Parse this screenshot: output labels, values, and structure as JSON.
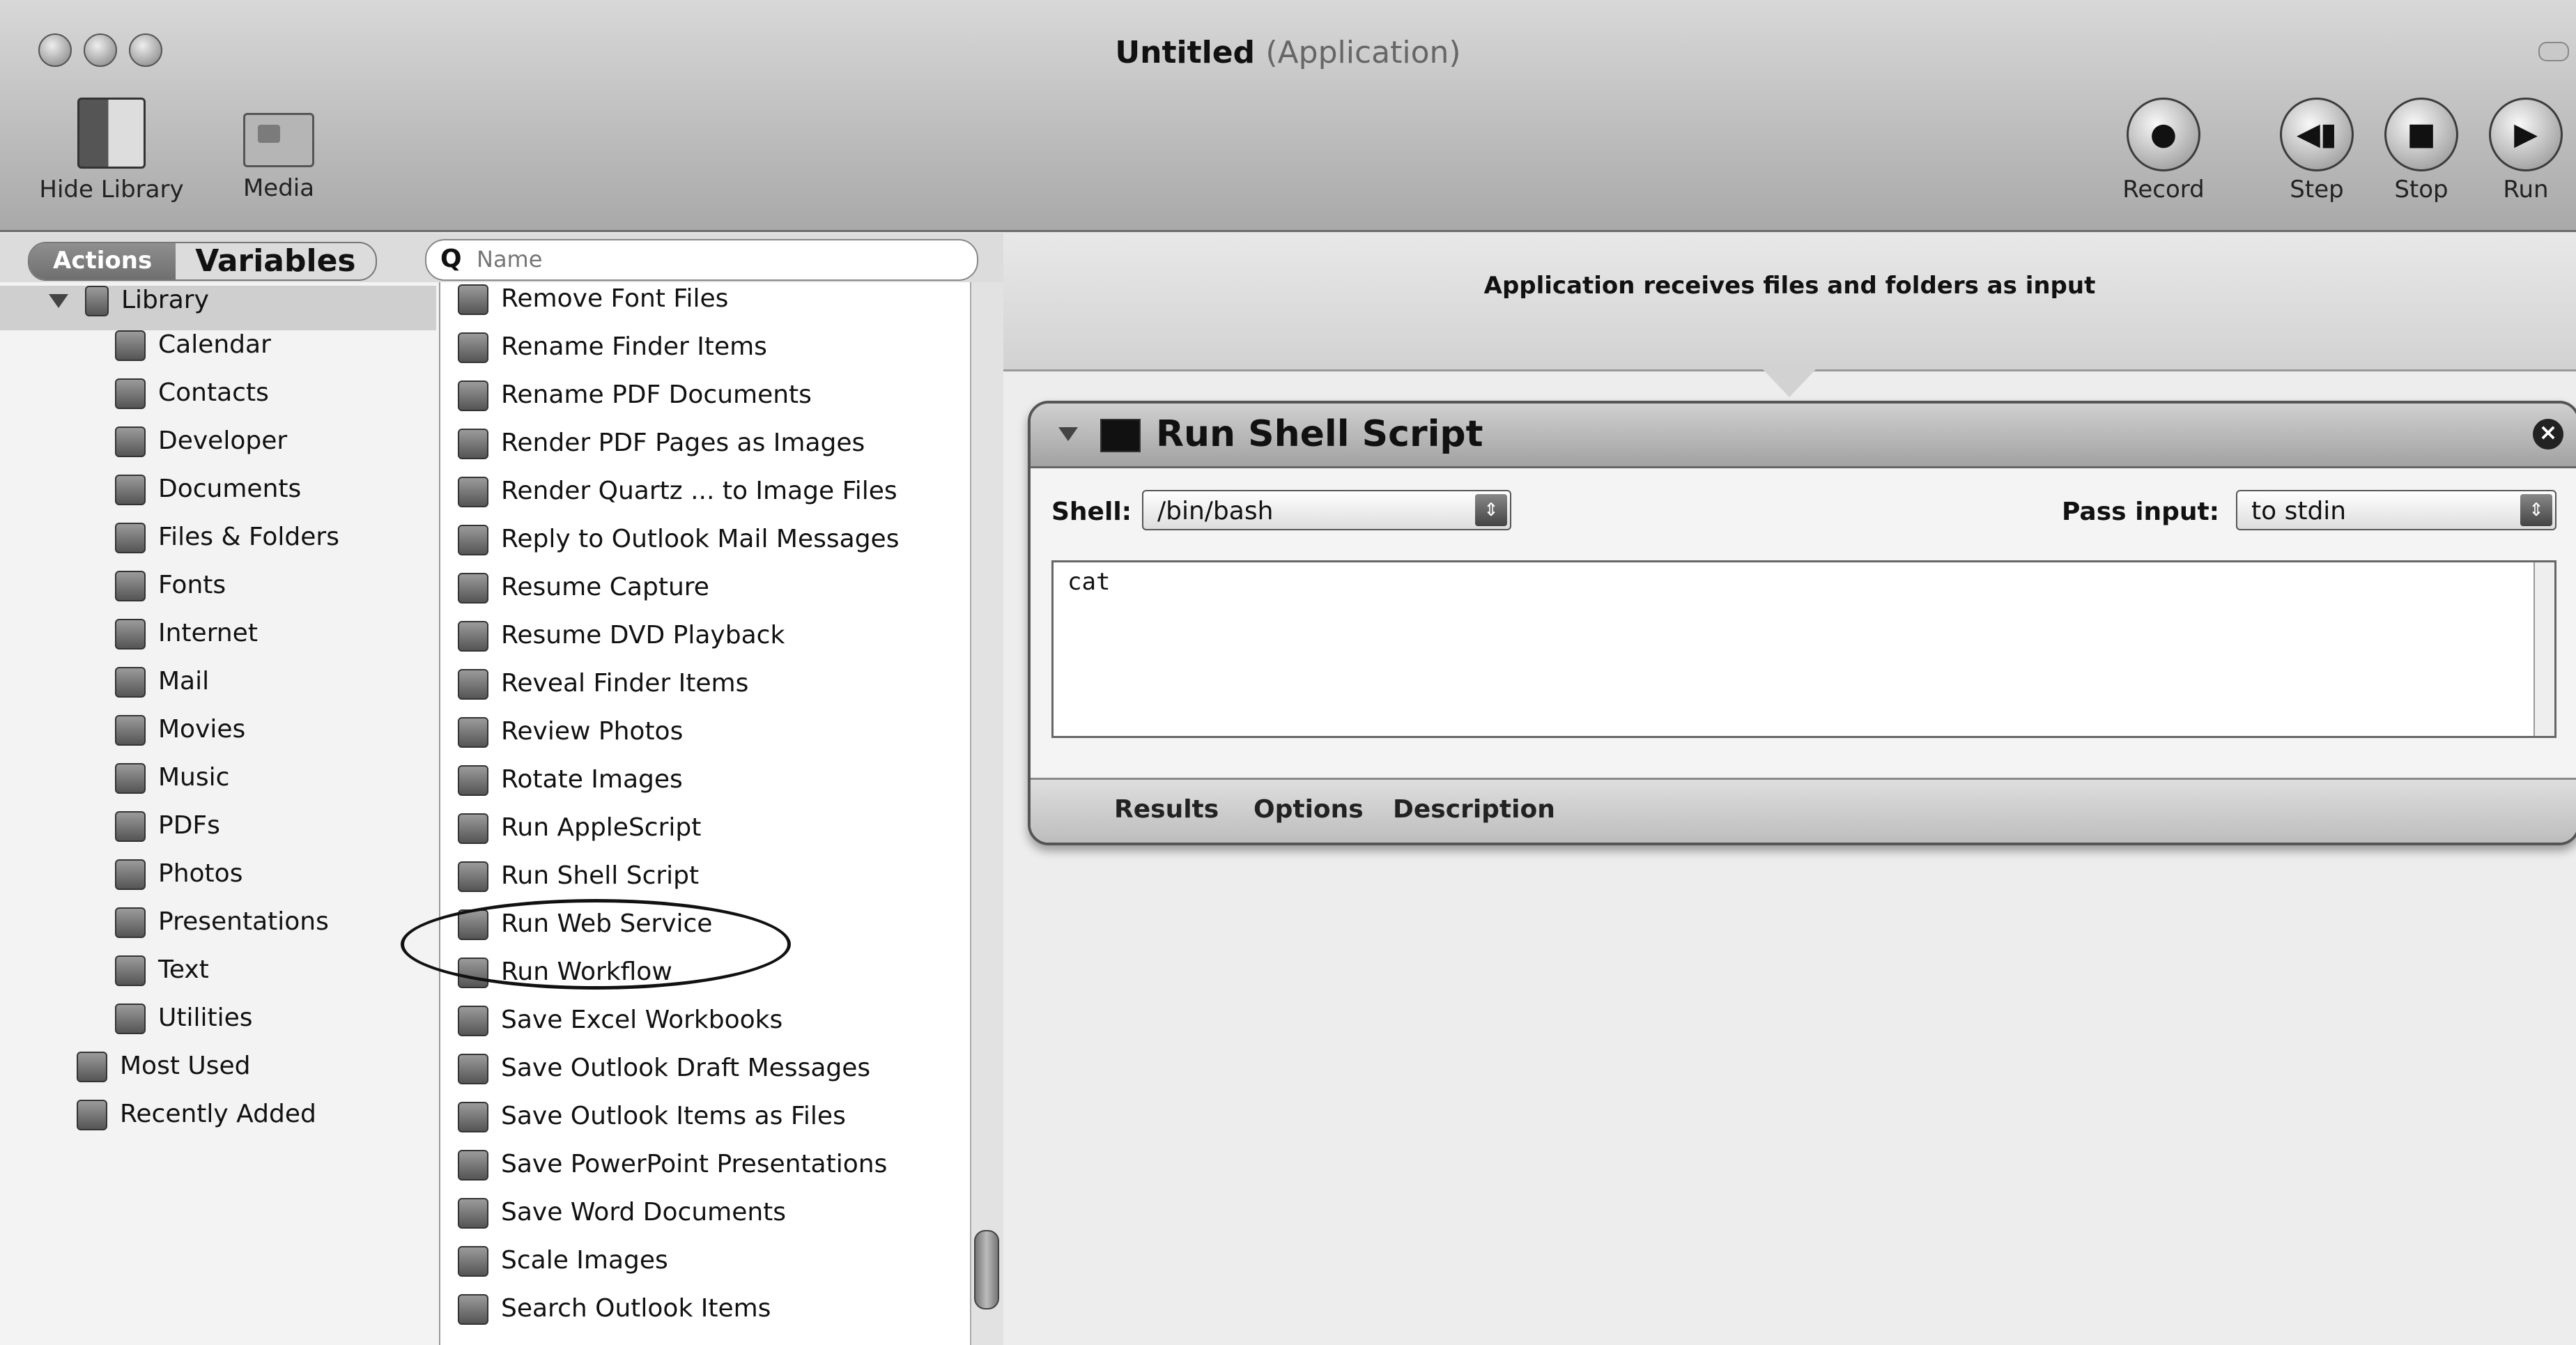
{
  "window": {
    "title": "Untitled",
    "subtitle": "(Application)"
  },
  "toolbar": {
    "hide_library": "Hide Library",
    "media": "Media",
    "record": "Record",
    "step": "Step",
    "stop": "Stop",
    "run": "Run"
  },
  "tabs": {
    "actions": "Actions",
    "variables": "Variables"
  },
  "search": {
    "placeholder": "Name"
  },
  "library": {
    "root": "Library",
    "items": [
      "Calendar",
      "Contacts",
      "Developer",
      "Documents",
      "Files & Folders",
      "Fonts",
      "Internet",
      "Mail",
      "Movies",
      "Music",
      "PDFs",
      "Photos",
      "Presentations",
      "Text",
      "Utilities"
    ],
    "extra": [
      "Most Used",
      "Recently Added"
    ]
  },
  "actions": [
    "Remove Font Files",
    "Rename Finder Items",
    "Rename PDF Documents",
    "Render PDF Pages as Images",
    "Render Quartz ... to Image Files",
    "Reply to Outlook Mail Messages",
    "Resume Capture",
    "Resume DVD Playback",
    "Reveal Finder Items",
    "Review Photos",
    "Rotate Images",
    "Run AppleScript",
    "Run Shell Script",
    "Run Web Service",
    "Run Workflow",
    "Save Excel Workbooks",
    "Save Outlook Draft Messages",
    "Save Outlook Items as Files",
    "Save PowerPoint Presentations",
    "Save Word Documents",
    "Scale Images",
    "Search Outlook Items"
  ],
  "workflow": {
    "input_banner": "Application receives files and folders as input",
    "action": {
      "title": "Run Shell Script",
      "shell_label": "Shell:",
      "shell_value": "/bin/bash",
      "pass_input_label": "Pass input:",
      "pass_input_value": "to stdin",
      "script": "cat",
      "footer_tabs": [
        "Results",
        "Options",
        "Description"
      ]
    }
  }
}
